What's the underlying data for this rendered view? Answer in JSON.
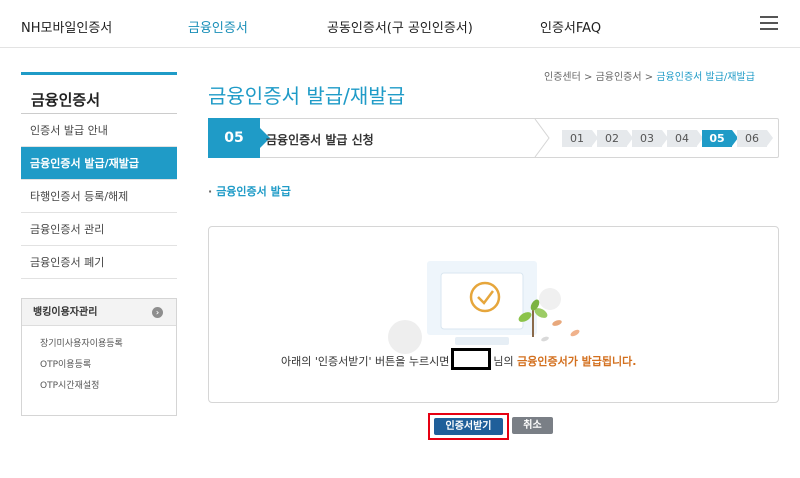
{
  "topnav": {
    "items": [
      "NH모바일인증서",
      "금융인증서",
      "공동인증서(구 공인인증서)",
      "인증서FAQ"
    ]
  },
  "sidebar": {
    "title": "금융인증서",
    "items": [
      "인증서 발급 안내",
      "금융인증서 발급/재발급",
      "타행인증서 등록/해제",
      "금융인증서 관리",
      "금융인증서 폐기"
    ],
    "bank_box": {
      "title": "뱅킹이용자관리",
      "links": [
        "장기미사용자이용등록",
        "OTP이용등록",
        "OTP시간재설정"
      ]
    }
  },
  "breadcrumb": {
    "items": [
      "인증센터",
      "금융인증서"
    ],
    "current": "금융인증서 발급/재발급",
    "separator": ">"
  },
  "page_title": "금융인증서 발급/재발급",
  "stepbar": {
    "current_number": "05",
    "current_label": "금융인증서 발급 신청",
    "steps": [
      "01",
      "02",
      "03",
      "04",
      "05",
      "06"
    ],
    "active_step": "05"
  },
  "section_heading": "금융인증서 발급",
  "notice": {
    "prefix": "아래의 '인증서받기' 버튼을 누르시면",
    "middle": "님의",
    "highlight": "금융인증서가 발급됩니다."
  },
  "buttons": {
    "issue": "인증서받기",
    "cancel": "취소"
  },
  "colors": {
    "accent": "#1f9bc7",
    "highlight": "#d3701f",
    "issue_button": "#1f5f9a",
    "focus_outline": "#e60012"
  }
}
